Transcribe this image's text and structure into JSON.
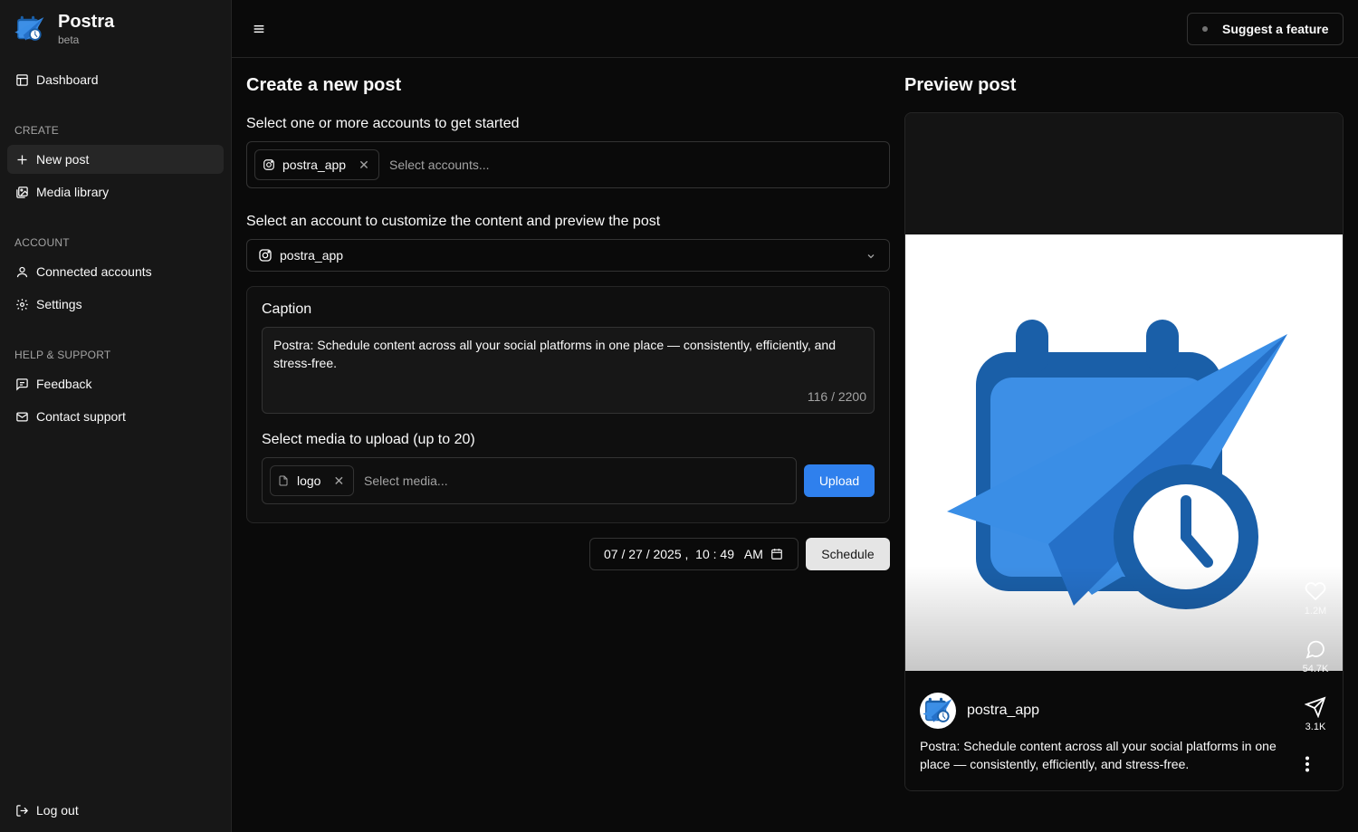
{
  "app": {
    "name": "Postra",
    "badge": "beta"
  },
  "sidebar": {
    "dashboard": "Dashboard",
    "sections": {
      "create": "CREATE",
      "account": "ACCOUNT",
      "help": "HELP & SUPPORT"
    },
    "items": {
      "new_post": "New post",
      "media_library": "Media library",
      "connected_accounts": "Connected accounts",
      "settings": "Settings",
      "feedback": "Feedback",
      "contact_support": "Contact support",
      "log_out": "Log out"
    }
  },
  "topbar": {
    "suggest_label": "Suggest a feature"
  },
  "editor": {
    "title": "Create a new post",
    "accounts_label": "Select one or more accounts to get started",
    "selected_account_chip": "postra_app",
    "accounts_placeholder": "Select accounts...",
    "customize_label": "Select an account to customize the content and preview the post",
    "customize_value": "postra_app",
    "caption_label": "Caption",
    "caption_text": "Postra: Schedule content across all your social platforms in one place — consistently, efficiently, and stress-free.",
    "caption_counter": "116 / 2200",
    "media_label": "Select media to upload (up to 20)",
    "media_chip": "logo",
    "media_placeholder": "Select media...",
    "upload_label": "Upload",
    "datetime": "07 / 27 / 2025 ,  10 : 49   AM",
    "schedule_label": "Schedule"
  },
  "preview": {
    "title": "Preview post",
    "username": "postra_app",
    "caption": "Postra: Schedule content across all your social platforms in one place — consistently, efficiently, and stress-free.",
    "likes": "1.2M",
    "comments": "54.7K",
    "shares": "3.1K"
  },
  "colors": {
    "background": "#0a0a0a",
    "sidebar": "#171717",
    "accent": "#2f80ed",
    "logo_dark_blue": "#1a5fa8",
    "logo_light_blue": "#3d8fe6"
  },
  "icons": {
    "logo": "postra-logo-icon",
    "dashboard": "layout-icon",
    "new_post": "plus-icon",
    "media_library": "images-icon",
    "connected_accounts": "user-icon",
    "settings": "gear-icon",
    "feedback": "message-square-icon",
    "contact_support": "mail-icon",
    "log_out": "log-out-icon",
    "menu": "menu-icon",
    "instagram": "instagram-icon",
    "like": "heart-icon",
    "comment": "message-circle-icon",
    "share": "send-icon",
    "more": "more-vertical-icon"
  }
}
